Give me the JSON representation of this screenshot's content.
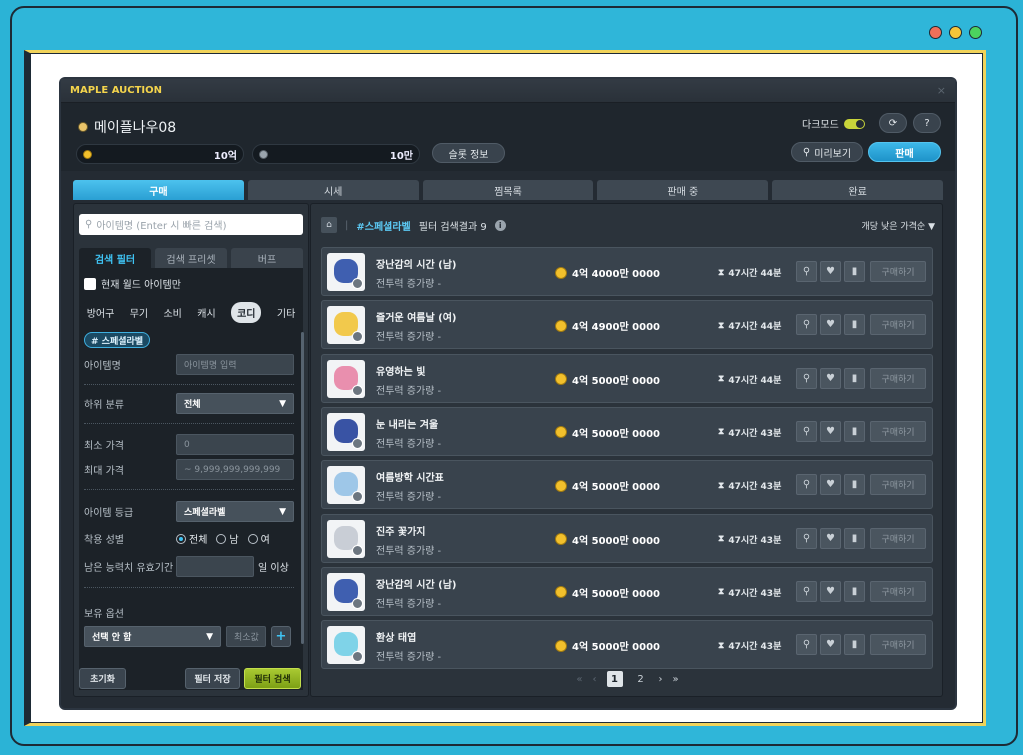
{
  "window_dots": [
    {
      "color": "#f0705a"
    },
    {
      "color": "#f7c53a"
    },
    {
      "color": "#4cd35e"
    }
  ],
  "app": {
    "title": "MAPLE AUCTION",
    "close": "×"
  },
  "header": {
    "character": "메이플나우08",
    "meso_value": "10억",
    "point_value": "10만",
    "slot_info": "슬롯 정보",
    "dark_mode": "다크모드",
    "refresh": "⟳",
    "help": "?",
    "preview": "미리보기",
    "sell": "판매"
  },
  "tabs": [
    "구매",
    "시세",
    "찜목록",
    "판매 중",
    "완료"
  ],
  "filter": {
    "search_placeholder": "아이템명 (Enter 시 빠른 검색)",
    "subtabs": [
      "검색 필터",
      "검색 프리셋",
      "버프"
    ],
    "current_world": "현재 월드 아이템만",
    "categories": [
      "방어구",
      "무기",
      "소비",
      "캐시",
      "코디",
      "기타"
    ],
    "active_tag": "# 스페셜라벨",
    "item_name_label": "아이템명",
    "item_name_placeholder": "아이템명 입력",
    "subcat_label": "하위 분류",
    "subcat_value": "전체",
    "min_price_label": "최소 가격",
    "min_price_value": "0",
    "max_price_label": "최대 가격",
    "max_price_value": "~ 9,999,999,999,999",
    "grade_label": "아이템 등급",
    "grade_value": "스페셜라벨",
    "gender_label": "착용 성별",
    "gender_options": [
      "전체",
      "남",
      "여"
    ],
    "ability_label": "남은 능력치 유효기간",
    "ability_suffix": "일 이상",
    "owned_label": "보유 옵션",
    "owned_select": "선택 안 함",
    "owned_min": "최소값",
    "add": "+",
    "reset": "초기화",
    "save": "필터 저장",
    "search": "필터 검색"
  },
  "results": {
    "home": "⌂",
    "title": "#스페셜라벨",
    "summary": "필터 검색결과 9",
    "info": "i",
    "sort": "개당 낮은 가격순 ▼",
    "rows": [
      {
        "name": "장난감의 시간 (남)",
        "sub": "전투력 증가량 -",
        "price": "4억 4000만 0000",
        "time": "47시간 44분",
        "buy": "구매하기",
        "color": "#3f5fb0"
      },
      {
        "name": "즐거운 여름날 (여)",
        "sub": "전투력 증가량 -",
        "price": "4억 4900만 0000",
        "time": "47시간 44분",
        "buy": "구매하기",
        "color": "#f2c94c"
      },
      {
        "name": "유영하는 빛",
        "sub": "전투력 증가량 -",
        "price": "4억 5000만 0000",
        "time": "47시간 44분",
        "buy": "구매하기",
        "color": "#e98fae"
      },
      {
        "name": "눈 내리는 겨울",
        "sub": "전투력 증가량 -",
        "price": "4억 5000만 0000",
        "time": "47시간 43분",
        "buy": "구매하기",
        "color": "#3953a4"
      },
      {
        "name": "여름방학 시간표",
        "sub": "전투력 증가량 -",
        "price": "4억 5000만 0000",
        "time": "47시간 43분",
        "buy": "구매하기",
        "color": "#9ec7e8"
      },
      {
        "name": "진주 꽃가지",
        "sub": "전투력 증가량 -",
        "price": "4억 5000만 0000",
        "time": "47시간 43분",
        "buy": "구매하기",
        "color": "#c9ced6"
      },
      {
        "name": "장난감의 시간 (남)",
        "sub": "전투력 증가량 -",
        "price": "4억 5000만 0000",
        "time": "47시간 43분",
        "buy": "구매하기",
        "color": "#3f5fb0"
      },
      {
        "name": "환상 태엽",
        "sub": "전투력 증가량 -",
        "price": "4억 5000만 0000",
        "time": "47시간 43분",
        "buy": "구매하기",
        "color": "#7fd3e8"
      }
    ],
    "pager": {
      "first": "«",
      "prev": "‹",
      "pages": [
        "1",
        "2"
      ],
      "next": "›",
      "last": "»"
    }
  }
}
